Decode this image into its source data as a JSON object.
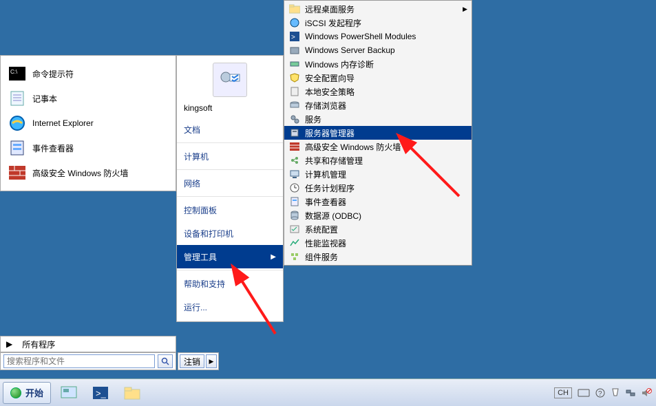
{
  "left_panel": {
    "items": [
      {
        "label": "命令提示符"
      },
      {
        "label": "记事本"
      },
      {
        "label": "Internet Explorer"
      },
      {
        "label": "事件查看器"
      },
      {
        "label": "高级安全 Windows 防火墙"
      }
    ]
  },
  "start_panel": {
    "username": "kingsoft",
    "items": [
      {
        "label": "文档"
      },
      {
        "label": "计算机"
      },
      {
        "label": "网络"
      },
      {
        "label": "控制面板"
      },
      {
        "label": "设备和打印机"
      },
      {
        "label": "管理工具",
        "submenu": true,
        "highlight": true
      },
      {
        "label": "帮助和支持"
      },
      {
        "label": "运行..."
      }
    ]
  },
  "allprograms_label": "所有程序",
  "search_placeholder": "搜索程序和文件",
  "logout_label": "注销",
  "submenu": {
    "items": [
      {
        "label": "远程桌面服务",
        "arrow": true,
        "icon": "folder"
      },
      {
        "label": "iSCSI 发起程序",
        "icon": "globe"
      },
      {
        "label": "Windows PowerShell Modules",
        "icon": "psmod"
      },
      {
        "label": "Windows Server Backup",
        "icon": "backup"
      },
      {
        "label": "Windows 内存诊断",
        "icon": "mem"
      },
      {
        "label": "安全配置向导",
        "icon": "shield"
      },
      {
        "label": "本地安全策略",
        "icon": "policy"
      },
      {
        "label": "存储浏览器",
        "icon": "storage"
      },
      {
        "label": "服务",
        "icon": "gears"
      },
      {
        "label": "服务器管理器",
        "highlight": true,
        "icon": "server"
      },
      {
        "label": "高级安全 Windows 防火墙",
        "icon": "firewall"
      },
      {
        "label": "共享和存储管理",
        "icon": "share"
      },
      {
        "label": "计算机管理",
        "icon": "compmgmt"
      },
      {
        "label": "任务计划程序",
        "icon": "task"
      },
      {
        "label": "事件查看器",
        "icon": "event"
      },
      {
        "label": "数据源 (ODBC)",
        "icon": "odbc"
      },
      {
        "label": "系统配置",
        "icon": "sysconf"
      },
      {
        "label": "性能监视器",
        "icon": "perf"
      },
      {
        "label": "组件服务",
        "icon": "comp"
      }
    ]
  },
  "taskbar": {
    "start_label": "开始",
    "ime_label": "CH"
  }
}
